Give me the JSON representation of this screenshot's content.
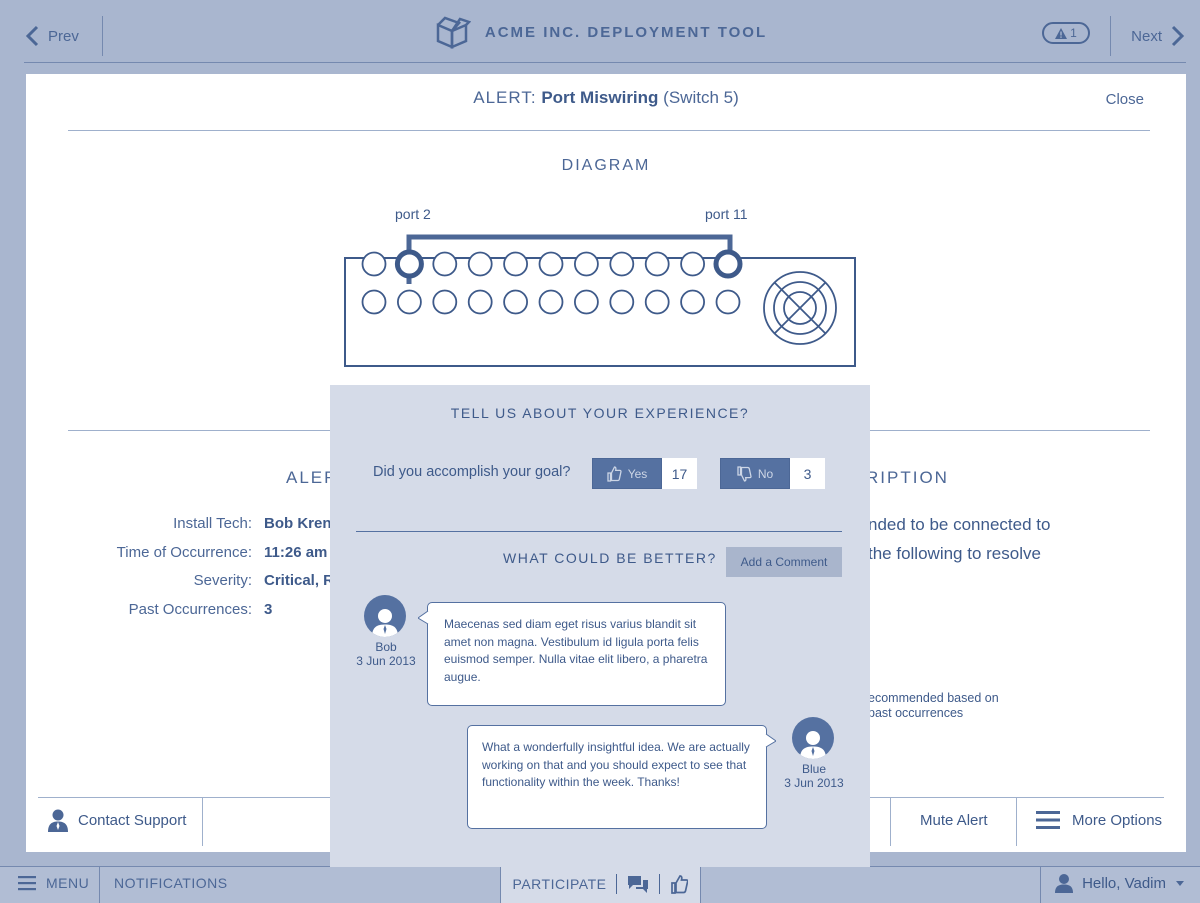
{
  "app": {
    "title": "ACME INC. DEPLOYMENT TOOL",
    "prev_label": "Prev",
    "next_label": "Next",
    "alert_count": "1"
  },
  "alert": {
    "prefix": "ALERT:",
    "name": "Port Miswiring",
    "device": "(Switch 5)",
    "close_label": "Close"
  },
  "diagram": {
    "title": "DIAGRAM",
    "port_a_label": "port 2",
    "port_b_label": "port 11"
  },
  "details": {
    "title_visible": "ALER",
    "rows": [
      {
        "key": "Install Tech:",
        "value": "Bob Krent"
      },
      {
        "key": "Time of Occurrence:",
        "value": "11:26 am"
      },
      {
        "key": "Severity:",
        "value": "Critical, R"
      },
      {
        "key": "Past Occurrences:",
        "value": "3"
      }
    ]
  },
  "description": {
    "title_visible": "RIPTION",
    "line1": "nded to be connected to",
    "line2": "the following to resolve",
    "rec_line1": "ecommended based on",
    "rec_line2": "past occurrences"
  },
  "actions": {
    "contact_support": "Contact Support",
    "mute_alert": "Mute Alert",
    "more_options": "More Options"
  },
  "bottom_bar": {
    "menu": "MENU",
    "notifications": "NOTIFICATIONS",
    "participate": "PARTICIPATE",
    "user_greeting": "Hello, Vadim"
  },
  "feedback": {
    "title": "TELL US ABOUT YOUR EXPERIENCE?",
    "question": "Did you accomplish your goal?",
    "yes_label": "Yes",
    "yes_count": "17",
    "no_label": "No",
    "no_count": "3",
    "better_title": "WHAT COULD BE BETTER?",
    "add_comment": "Add a Comment",
    "comments": [
      {
        "author": "Bob",
        "date": "3 Jun 2013",
        "text": "Maecenas sed diam eget risus varius blandit sit amet non magna. Vestibulum id ligula porta felis euismod semper. Nulla vitae elit libero, a pharetra augue."
      },
      {
        "author": "Blue",
        "date": "3 Jun 2013",
        "text": "What a wonderfully insightful idea. We are actually working on that and you should expect to see that functionality within the week. Thanks!"
      }
    ]
  },
  "colors": {
    "background": "#a9b6cf",
    "accent": "#4c6796",
    "text": "#3e5a8a",
    "modal": "#d5dbe8",
    "panel": "#ffffff"
  }
}
